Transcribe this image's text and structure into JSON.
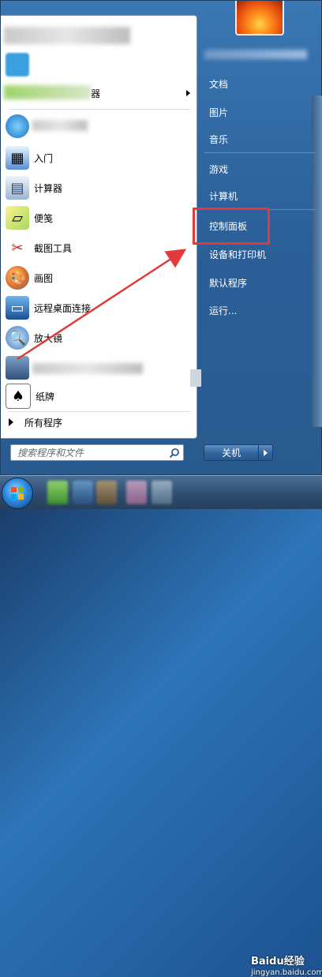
{
  "left_pane": {
    "items": [
      {
        "label": "",
        "icon": "blurred-icon"
      },
      {
        "label": "",
        "icon": "blurred-icon"
      },
      {
        "label": "器",
        "icon": "blurred-icon"
      },
      {
        "label": "",
        "icon": "ie-icon"
      },
      {
        "label": "入门",
        "icon": "getting-started-icon"
      },
      {
        "label": "计算器",
        "icon": "calculator-icon"
      },
      {
        "label": "便笺",
        "icon": "sticky-notes-icon"
      },
      {
        "label": "截图工具",
        "icon": "snipping-tool-icon"
      },
      {
        "label": "画图",
        "icon": "paint-icon"
      },
      {
        "label": "远程桌面连接",
        "icon": "remote-desktop-icon"
      },
      {
        "label": "放大镜",
        "icon": "magnifier-icon"
      },
      {
        "label": "",
        "icon": "blurred-icon"
      },
      {
        "label": "纸牌",
        "icon": "solitaire-icon"
      }
    ],
    "all_programs": "所有程序",
    "search_placeholder": "搜索程序和文件"
  },
  "right_pane": {
    "items": [
      {
        "label": "文档"
      },
      {
        "label": "图片"
      },
      {
        "label": "音乐"
      },
      {
        "label": "游戏"
      },
      {
        "label": "计算机"
      },
      {
        "label": "控制面板"
      },
      {
        "label": "设备和打印机"
      },
      {
        "label": "默认程序"
      },
      {
        "label": "运行..."
      }
    ],
    "shutdown_label": "关机"
  },
  "taskbar": {
    "watermark": "Baidu经验",
    "watermark_url": "jingyan.baidu.com"
  },
  "annotation_color": "#e23a3a"
}
